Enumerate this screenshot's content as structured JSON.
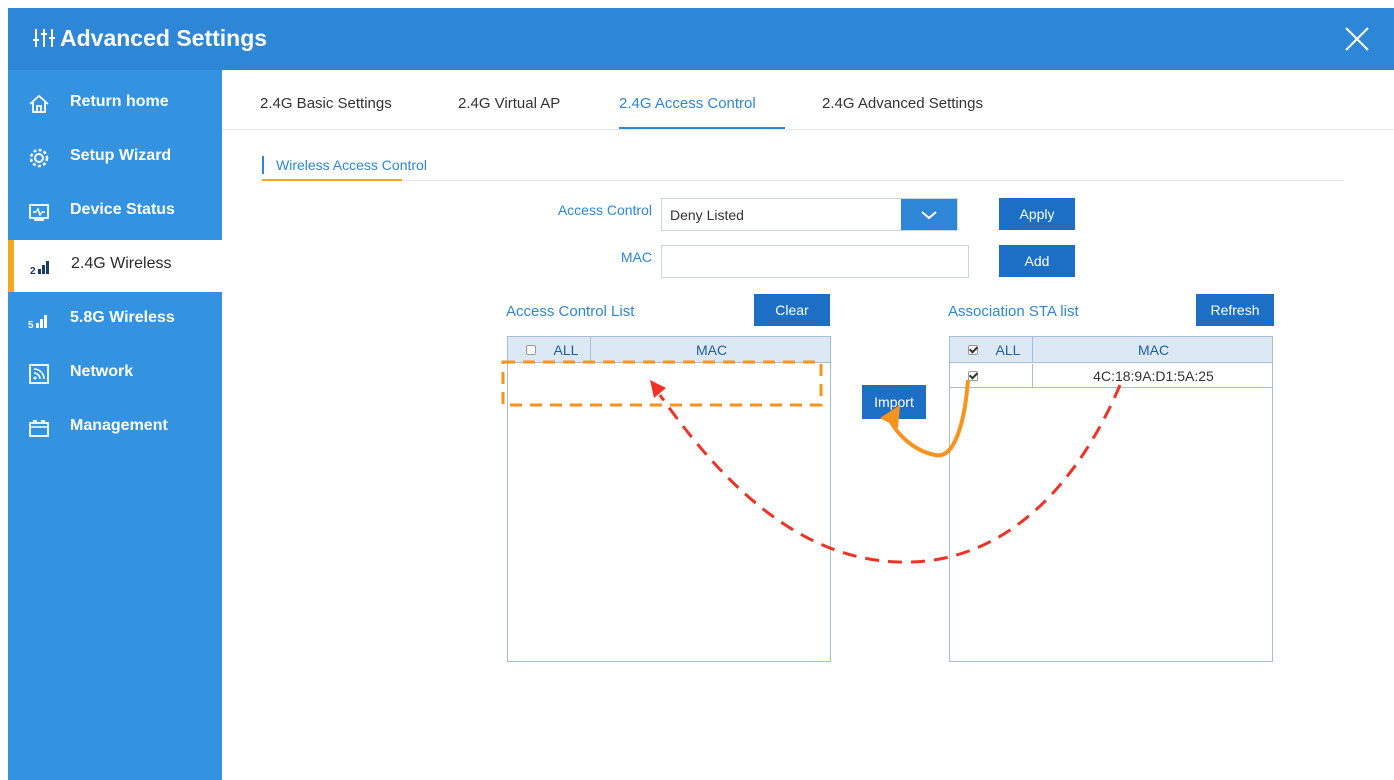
{
  "window": {
    "title": "Advanced Settings",
    "title_icon": "sliders-icon",
    "close_icon": "close-icon"
  },
  "sidebar": {
    "items": [
      {
        "label": "Return home",
        "icon": "home-icon"
      },
      {
        "label": "Setup Wizard",
        "icon": "gear-icon"
      },
      {
        "label": "Device Status",
        "icon": "monitor-icon"
      },
      {
        "label": "2.4G Wireless",
        "icon": "signal-2g-icon",
        "active": true
      },
      {
        "label": "5.8G Wireless",
        "icon": "signal-5g-icon"
      },
      {
        "label": "Network",
        "icon": "network-icon"
      },
      {
        "label": "Management",
        "icon": "management-icon"
      }
    ]
  },
  "tabs": [
    {
      "label": "2.4G Basic Settings"
    },
    {
      "label": "2.4G Virtual AP"
    },
    {
      "label": "2.4G Access Control",
      "active": true
    },
    {
      "label": "2.4G Advanced Settings"
    }
  ],
  "section": {
    "title": "Wireless Access Control"
  },
  "form": {
    "access_control_label": "Access Control",
    "access_control_value": "Deny Listed",
    "apply_label": "Apply",
    "mac_label": "MAC",
    "mac_value": "",
    "add_label": "Add"
  },
  "acl": {
    "title": "Access Control List",
    "clear_label": "Clear",
    "col_all": "ALL",
    "col_mac": "MAC",
    "all_checked": false,
    "rows": []
  },
  "import_label": "Import",
  "sta": {
    "title": "Association STA list",
    "refresh_label": "Refresh",
    "col_all": "ALL",
    "col_mac": "MAC",
    "all_checked": true,
    "rows": [
      {
        "checked": true,
        "mac": "4C:18:9A:D1:5A:25"
      }
    ]
  },
  "colors": {
    "titlebar": "#2e86d6",
    "sidebar": "#3393e0",
    "active_accent": "#f5a623",
    "button": "#1c6fc4",
    "annotation_orange": "#f7931e",
    "annotation_red": "#ee3324"
  }
}
